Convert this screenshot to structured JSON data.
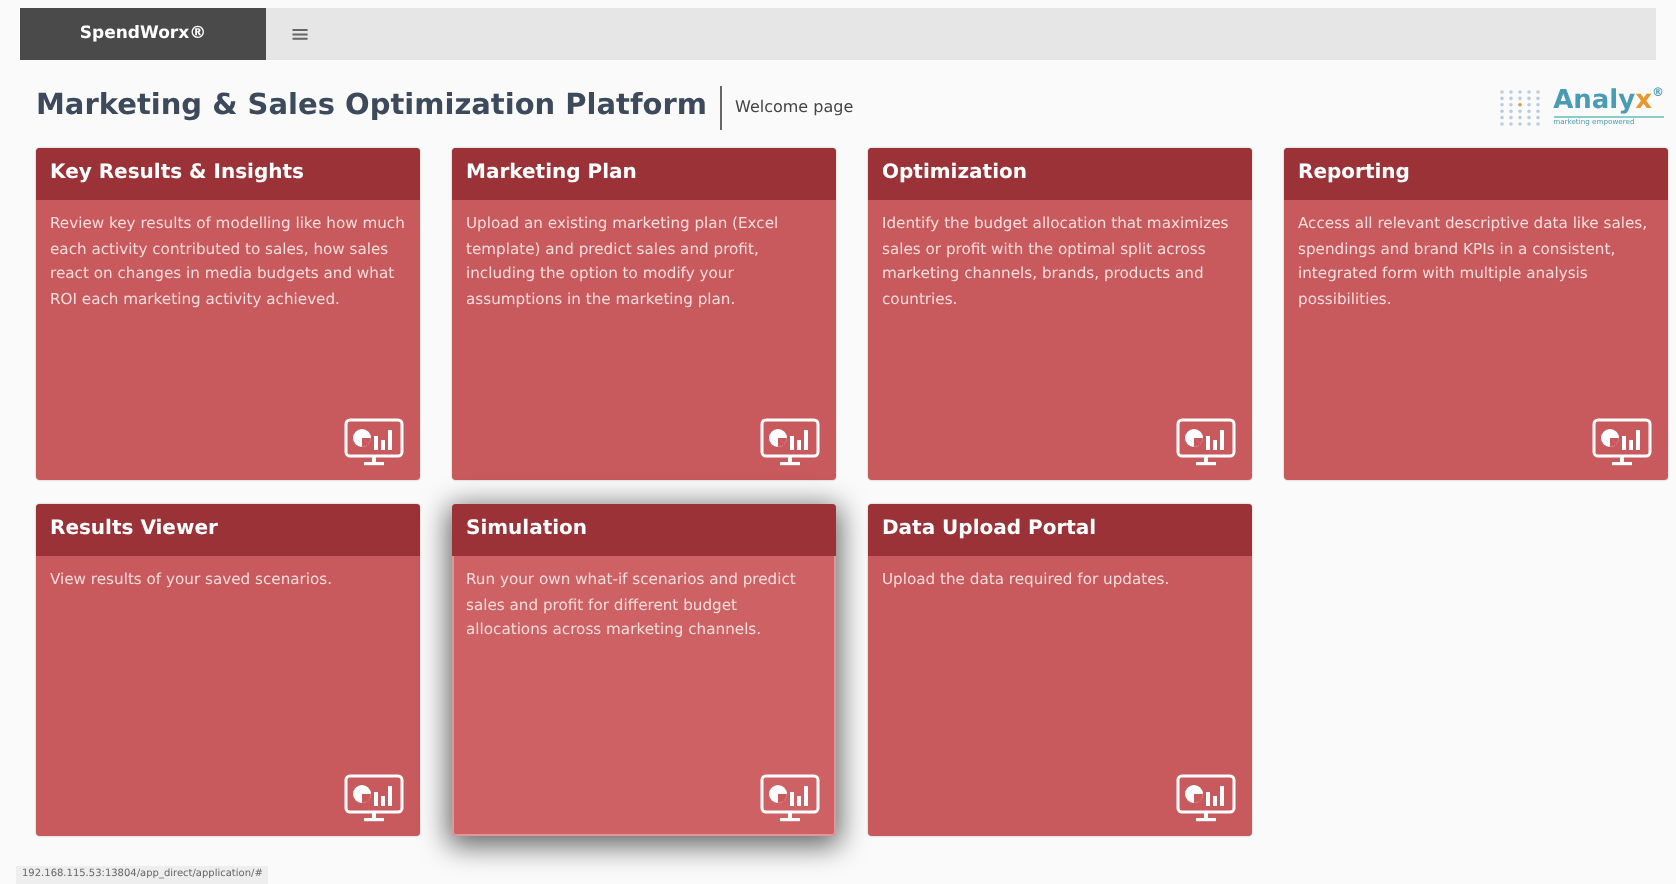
{
  "topbar": {
    "brand": "SpendWorx®",
    "menu_glyph": "≡"
  },
  "header": {
    "title": "Marketing & Sales Optimization Platform",
    "subtitle": "Welcome page",
    "logo": {
      "name": "Analy",
      "accent": "x",
      "mark": "®",
      "tagline": "marketing empowered"
    }
  },
  "tiles": [
    {
      "title": "Key Results & Insights",
      "text": "Review key results of modelling like how much each activity contributed to sales, how sales react on changes in media budgets and what ROI each marketing activity achieved.",
      "highlighted": false
    },
    {
      "title": "Marketing Plan",
      "text": "Upload an existing marketing plan (Excel template) and predict sales and profit, including the option to modify your assumptions in the marketing plan.",
      "highlighted": false
    },
    {
      "title": "Optimization",
      "text": "Identify the budget allocation that maximizes sales or profit with the optimal split across marketing channels, brands, products and countries.",
      "highlighted": false
    },
    {
      "title": "Reporting",
      "text": "Access all relevant descriptive data like sales, spendings and brand KPIs in a consistent, integrated form with multiple analysis possibilities.",
      "highlighted": false
    },
    {
      "title": "Results Viewer",
      "text": "View results of your saved scenarios.",
      "highlighted": false
    },
    {
      "title": "Simulation",
      "text": "Run your own what-if scenarios and predict sales and profit for different budget allocations across marketing channels.",
      "highlighted": true
    },
    {
      "title": "Data Upload Portal",
      "text": "Upload the data required for updates.",
      "highlighted": false
    }
  ],
  "status_bar": {
    "url": "192.168.115.53:13804/app_direct/application/#"
  }
}
